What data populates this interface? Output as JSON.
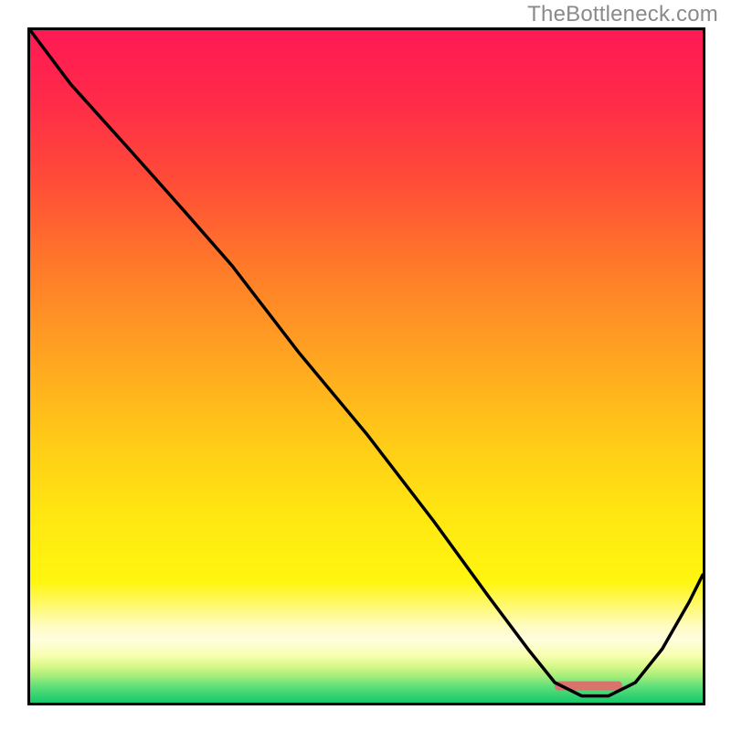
{
  "attribution": "TheBottleneck.com",
  "gradient_stops": [
    {
      "offset": 0.0,
      "color": "#ff1a55"
    },
    {
      "offset": 0.1,
      "color": "#ff2a4a"
    },
    {
      "offset": 0.22,
      "color": "#ff4b38"
    },
    {
      "offset": 0.35,
      "color": "#ff7a2a"
    },
    {
      "offset": 0.48,
      "color": "#ffa322"
    },
    {
      "offset": 0.6,
      "color": "#ffc818"
    },
    {
      "offset": 0.72,
      "color": "#ffe712"
    },
    {
      "offset": 0.82,
      "color": "#fff60f"
    },
    {
      "offset": 0.885,
      "color": "#fffcbf"
    },
    {
      "offset": 0.905,
      "color": "#fffde0"
    },
    {
      "offset": 0.93,
      "color": "#f8ffb0"
    },
    {
      "offset": 0.945,
      "color": "#d8f98a"
    },
    {
      "offset": 0.96,
      "color": "#a8ee7a"
    },
    {
      "offset": 0.975,
      "color": "#63e07a"
    },
    {
      "offset": 1.0,
      "color": "#15c96b"
    }
  ],
  "chart_data": {
    "type": "line",
    "title": "",
    "xlabel": "",
    "ylabel": "",
    "xlim": [
      0,
      100
    ],
    "ylim": [
      0,
      100
    ],
    "series": [
      {
        "name": "bottleneck-curve",
        "x": [
          0,
          6,
          15,
          23,
          30,
          40,
          50,
          60,
          68,
          74,
          78,
          82,
          86,
          90,
          94,
          98,
          100
        ],
        "y": [
          100,
          92,
          82,
          73,
          65,
          52,
          40,
          27,
          16,
          8,
          3,
          1,
          1,
          3,
          8,
          15,
          19
        ]
      }
    ],
    "marker": {
      "name": "optimal-range-marker",
      "x_start": 78,
      "x_end": 88,
      "y": 2.5,
      "color": "#d9746c"
    }
  }
}
